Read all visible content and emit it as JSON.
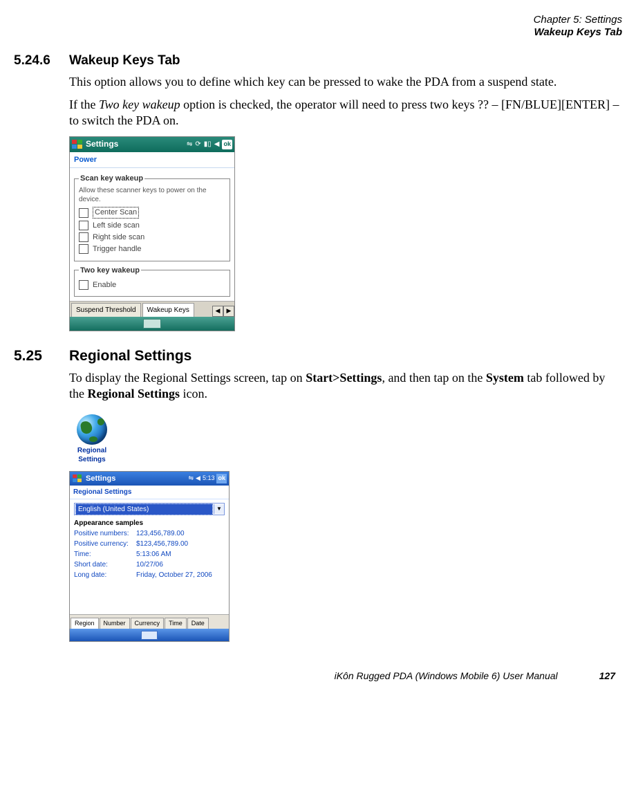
{
  "header": {
    "chapter": "Chapter 5:  Settings",
    "section": "Wakeup Keys Tab"
  },
  "s1": {
    "num": "5.24.6",
    "title": "Wakeup Keys Tab",
    "p1": "This option allows you to define which key can be pressed to wake the PDA from a suspend state.",
    "p2a": "If the ",
    "p2i": "Two key wakeup",
    "p2b": " option is checked, the operator will need to press two keys ?? – [FN/BLUE][ENTER] – to switch the PDA on."
  },
  "pda1": {
    "title": "Settings",
    "ok": "ok",
    "sub": "Power",
    "fs1": {
      "legend": "Scan key wakeup",
      "help": "Allow these scanner keys to power on the device.",
      "opts": [
        "Center Scan",
        "Left side scan",
        "Right side scan",
        "Trigger handle"
      ]
    },
    "fs2": {
      "legend": "Two key wakeup",
      "opt": "Enable"
    },
    "tabs": [
      "Suspend Threshold",
      "Wakeup Keys"
    ]
  },
  "s2": {
    "num": "5.25",
    "title": "Regional Settings",
    "p1a": "To display the Regional Settings screen, tap on ",
    "p1b": "Start>Settings",
    "p1c": ", and then tap on the ",
    "p1d": "System",
    "p1e": " tab followed by the ",
    "p1f": "Regional Settings",
    "p1g": " icon."
  },
  "regicon": {
    "line1": "Regional",
    "line2": "Settings"
  },
  "pda2": {
    "title": "Settings",
    "time": "5:13",
    "ok": "ok",
    "sub": "Regional Settings",
    "combo": "English (United States)",
    "samples_hdr": "Appearance samples",
    "rows": [
      {
        "l": "Positive numbers:",
        "v": "123,456,789.00"
      },
      {
        "l": "Positive currency:",
        "v": "$123,456,789.00"
      },
      {
        "l": "Time:",
        "v": "5:13:06 AM"
      },
      {
        "l": "Short date:",
        "v": "10/27/06"
      },
      {
        "l": "Long date:",
        "v": "Friday, October 27, 2006"
      }
    ],
    "tabs": [
      "Region",
      "Number",
      "Currency",
      "Time",
      "Date"
    ]
  },
  "footer": {
    "text": "iKôn Rugged PDA (Windows Mobile 6) User Manual",
    "page": "127"
  }
}
